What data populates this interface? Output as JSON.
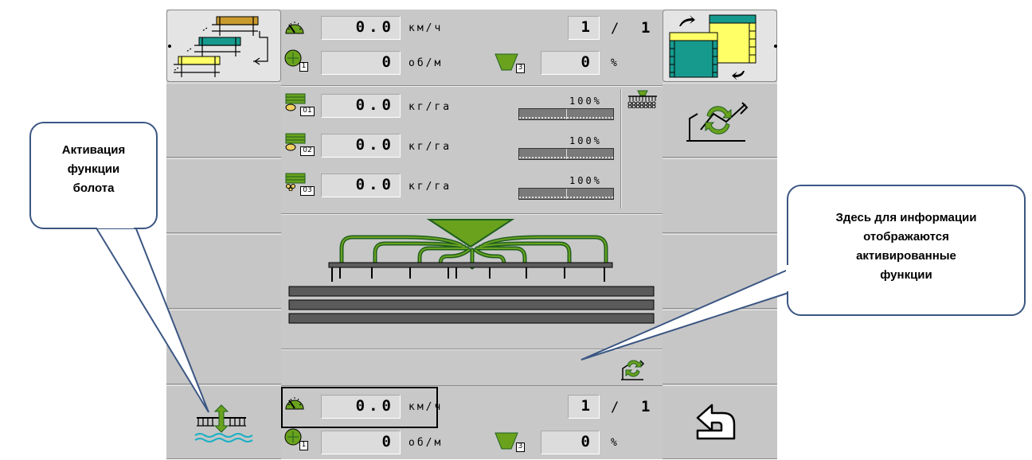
{
  "colors": {
    "panel": "#c8c8c8",
    "field": "#dcdcdc",
    "accent_green": "#6aa21e",
    "dark_green": "#1f5f1f",
    "teal": "#179a8e",
    "yellow": "#ffff66",
    "callout_border": "#3b5683"
  },
  "header": {
    "speed": {
      "value": "0.0",
      "unit": "км/ч"
    },
    "rpm": {
      "value": "0",
      "unit": "об/м",
      "index": "1"
    },
    "fill": {
      "value": "0",
      "unit": "%",
      "index": "3"
    },
    "counter": {
      "left": "1",
      "sep": "/",
      "right": "1"
    }
  },
  "metering": [
    {
      "value": "0.0",
      "unit": "кг/га",
      "index": "01",
      "percent": "100%",
      "icon": "seed-hopper-icon"
    },
    {
      "value": "0.0",
      "unit": "кг/га",
      "index": "02",
      "percent": "100%",
      "icon": "fertilizer-hopper-icon"
    },
    {
      "value": "0.0",
      "unit": "кг/га",
      "index": "03",
      "percent": "100%",
      "icon": "microgranulate-hopper-icon"
    }
  ],
  "footer": {
    "speed": {
      "value": "0.0",
      "unit": "км/ч"
    },
    "rpm": {
      "value": "0",
      "unit": "об/м",
      "index": "1"
    },
    "fill": {
      "value": "0",
      "unit": "%",
      "index": "3"
    },
    "counter": {
      "left": "1",
      "sep": "/",
      "right": "1"
    }
  },
  "left_softkeys": [
    "mask-switch-icon",
    "",
    "",
    "",
    "",
    "swamp-function-icon"
  ],
  "right_softkeys": [
    "screen-switch-icon",
    "marker-toggle-icon",
    "",
    "",
    "",
    "back-icon"
  ],
  "callouts": {
    "left": [
      "Активация",
      "функции",
      "болота"
    ],
    "right": [
      "Здесь для информации",
      "отображаются",
      "активированные",
      "функции"
    ]
  }
}
